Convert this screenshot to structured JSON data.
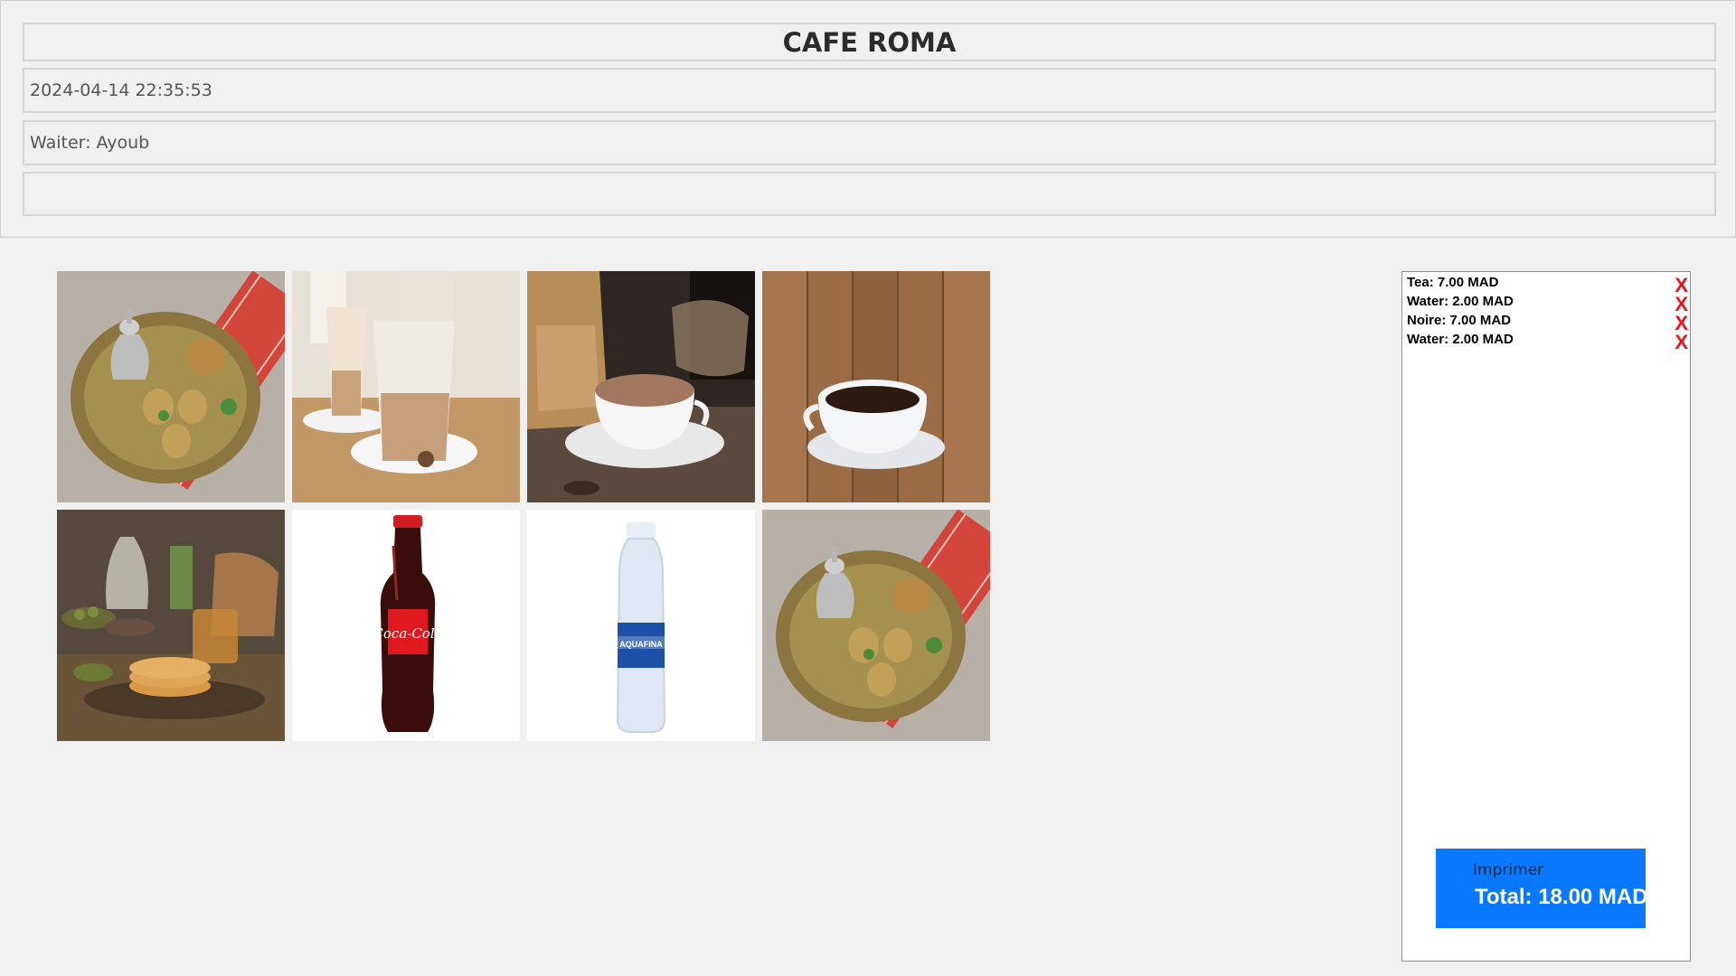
{
  "header": {
    "title": "CAFE ROMA",
    "datetime": "2024-04-14 22:35:53",
    "waiter": "Waiter: Ayoub",
    "extra": ""
  },
  "menu": {
    "items": [
      {
        "icon": "moroccan-tea-tray-image"
      },
      {
        "icon": "latte-glasses-image"
      },
      {
        "icon": "hot-chocolate-cup-image"
      },
      {
        "icon": "black-coffee-cup-image"
      },
      {
        "icon": "moroccan-breakfast-image"
      },
      {
        "icon": "coca-cola-bottle-image"
      },
      {
        "icon": "water-bottle-image"
      },
      {
        "icon": "moroccan-tea-tray-image"
      }
    ]
  },
  "order": {
    "items": [
      {
        "label": "Tea: 7.00 MAD",
        "remove": "X"
      },
      {
        "label": "Water: 2.00 MAD",
        "remove": "X"
      },
      {
        "label": "Noire: 7.00 MAD",
        "remove": "X"
      },
      {
        "label": "Water: 2.00 MAD",
        "remove": "X"
      }
    ],
    "print_label": "Imprimer",
    "total": "Total: 18.00 MAD"
  },
  "colors": {
    "background": "#f0f0f0",
    "print_button": "#0a78ff",
    "remove": "#e8141c"
  }
}
